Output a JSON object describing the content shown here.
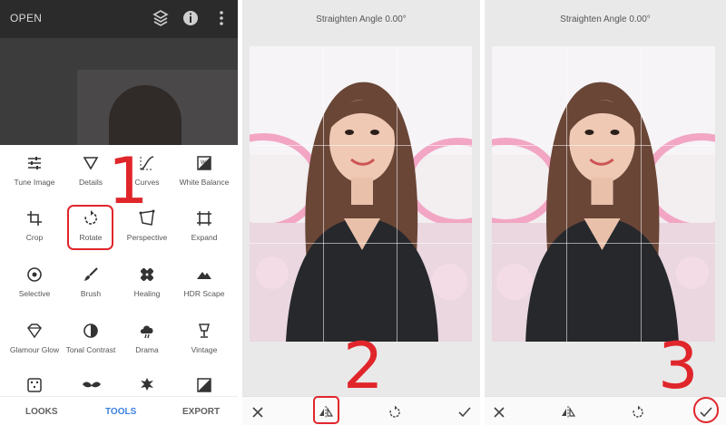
{
  "panel1": {
    "open_label": "OPEN",
    "tools": [
      {
        "label": "Tune Image",
        "icon": "tune-sliders-icon"
      },
      {
        "label": "Details",
        "icon": "details-triangle-icon"
      },
      {
        "label": "Curves",
        "icon": "curves-icon"
      },
      {
        "label": "White Balance",
        "icon": "white-balance-icon"
      },
      {
        "label": "Crop",
        "icon": "crop-icon"
      },
      {
        "label": "Rotate",
        "icon": "rotate-icon"
      },
      {
        "label": "Perspective",
        "icon": "perspective-icon"
      },
      {
        "label": "Expand",
        "icon": "expand-icon"
      },
      {
        "label": "Selective",
        "icon": "selective-icon"
      },
      {
        "label": "Brush",
        "icon": "brush-icon"
      },
      {
        "label": "Healing",
        "icon": "healing-icon"
      },
      {
        "label": "HDR Scape",
        "icon": "hdr-mountain-icon"
      },
      {
        "label": "Glamour Glow",
        "icon": "glamour-glow-icon"
      },
      {
        "label": "Tonal Contrast",
        "icon": "tonal-contrast-icon"
      },
      {
        "label": "Drama",
        "icon": "drama-cloud-icon"
      },
      {
        "label": "Vintage",
        "icon": "vintage-lamp-icon"
      }
    ],
    "nav": {
      "looks": "LOOKS",
      "tools": "TOOLS",
      "export": "EXPORT"
    },
    "step_number": "1"
  },
  "panel2": {
    "title": "Straighten Angle 0.00°",
    "step_number": "2"
  },
  "panel3": {
    "title": "Straighten Angle 0.00°",
    "step_number": "3"
  },
  "colors": {
    "accent_red": "#e0262b",
    "active_tab_blue": "#3b7fe0"
  }
}
